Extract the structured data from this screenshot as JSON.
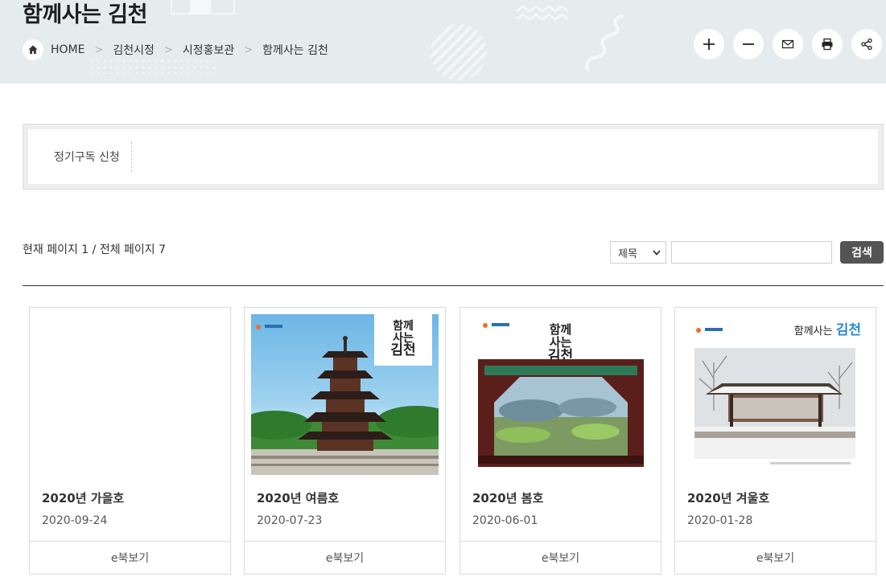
{
  "header": {
    "title": "함께사는 김천",
    "breadcrumb": [
      {
        "label": "HOME"
      },
      {
        "label": "김천시정"
      },
      {
        "label": "시정홍보관"
      },
      {
        "label": "함께사는 김천"
      }
    ],
    "tools": [
      {
        "icon": "zoom-in-icon"
      },
      {
        "icon": "zoom-out-icon"
      },
      {
        "icon": "mail-icon"
      },
      {
        "icon": "print-icon"
      },
      {
        "icon": "share-icon"
      }
    ]
  },
  "tabs": [
    {
      "label": "정기구독 신청"
    }
  ],
  "list": {
    "page_info": "현재 페이지 1 / 전체 페이지 7",
    "search": {
      "select_value": "제목",
      "input_value": "",
      "button_label": "검색"
    }
  },
  "cards": [
    {
      "title": "2020년 가을호",
      "date": "2020-09-24",
      "ebook_label": "e북보기",
      "cover": "empty"
    },
    {
      "title": "2020년 여름호",
      "date": "2020-07-23",
      "ebook_label": "e북보기",
      "cover": "pagoda",
      "cover_title": [
        "함께",
        "사는",
        "김천"
      ]
    },
    {
      "title": "2020년 봄호",
      "date": "2020-06-01",
      "ebook_label": "e북보기",
      "cover": "pavilion",
      "cover_title": [
        "함께",
        "사는",
        "김천"
      ]
    },
    {
      "title": "2020년 겨울호",
      "date": "2020-01-28",
      "ebook_label": "e북보기",
      "cover": "snow",
      "cover_title": [
        "함께사는",
        "김천"
      ]
    }
  ],
  "colors": {
    "banner_bg": "#e6ebee",
    "search_button": "#545454",
    "divider": "#333333"
  }
}
